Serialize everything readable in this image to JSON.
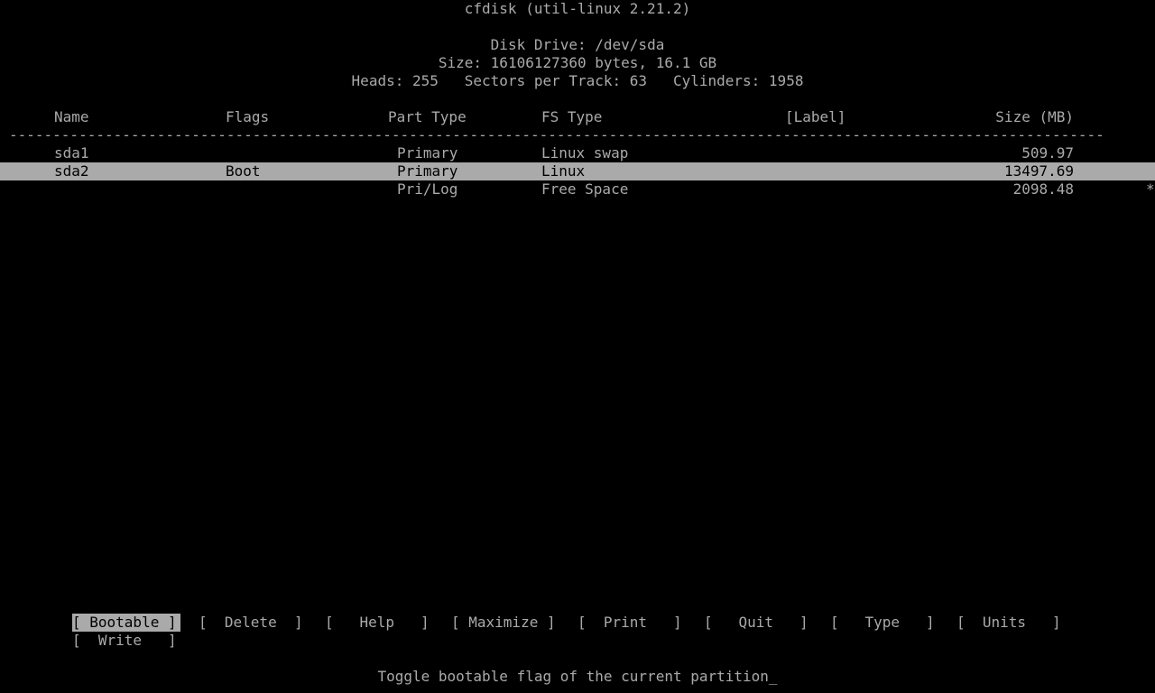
{
  "header": {
    "title": "cfdisk (util-linux 2.21.2)",
    "disk_drive": "Disk Drive: /dev/sda",
    "size": "Size: 16106127360 bytes, 16.1 GB",
    "geometry": "Heads: 255   Sectors per Track: 63   Cylinders: 1958"
  },
  "table": {
    "columns": {
      "name": "Name",
      "flags": "Flags",
      "part_type": "Part Type",
      "fs_type": "FS Type",
      "label": "[Label]",
      "size": "Size (MB)"
    },
    "separator": "------------------------------------------------------------------------------------------------------------------------------",
    "rows": [
      {
        "name": "sda1",
        "flags": "",
        "part_type": "Primary",
        "fs_type": "Linux swap",
        "label": "",
        "size": "509.97",
        "marker": "",
        "selected": false
      },
      {
        "name": "sda2",
        "flags": "Boot",
        "part_type": "Primary",
        "fs_type": "Linux",
        "label": "",
        "size": "13497.69",
        "marker": "",
        "selected": true
      },
      {
        "name": "",
        "flags": "",
        "part_type": "Pri/Log",
        "fs_type": "Free Space",
        "label": "",
        "size": "2098.48",
        "marker": "*",
        "selected": false
      }
    ]
  },
  "menu": {
    "buttons": [
      {
        "label": "[ Bootable ]",
        "active": true
      },
      {
        "label": "[  Delete  ]",
        "active": false
      },
      {
        "label": "[   Help   ]",
        "active": false
      },
      {
        "label": "[ Maximize ]",
        "active": false
      },
      {
        "label": "[  Print   ]",
        "active": false
      },
      {
        "label": "[   Quit   ]",
        "active": false
      },
      {
        "label": "[   Type   ]",
        "active": false
      },
      {
        "label": "[  Units   ]",
        "active": false
      },
      {
        "label": "[  Write   ]",
        "active": false
      }
    ]
  },
  "status": {
    "message": "Toggle bootable flag of the current partition",
    "cursor": "_"
  }
}
